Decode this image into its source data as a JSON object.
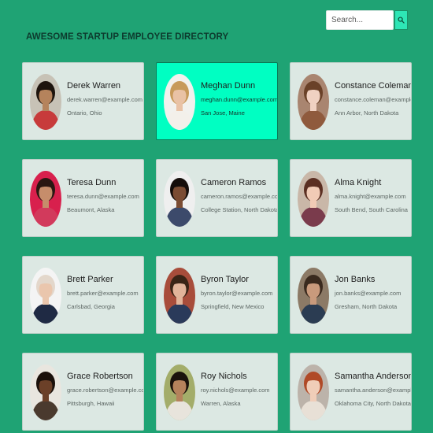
{
  "header": {
    "title": "AWESOME STARTUP EMPLOYEE DIRECTORY",
    "search": {
      "placeholder": "Search...",
      "value": "",
      "button_icon": "search-icon"
    }
  },
  "colors": {
    "background": "#1fa374",
    "card": "#dce8e3",
    "card_highlight": "#00ffc2",
    "search_button": "#2ee6b6"
  },
  "employees": [
    {
      "name": "Derek Warren",
      "email": "derek.warren@example.com",
      "location": "Ontario, Ohio",
      "highlighted": false,
      "skin": "#b5835c",
      "hair": "#1e140d",
      "shirt": "#c73b3b",
      "bg": "#c7c2b6"
    },
    {
      "name": "Meghan Dunn",
      "email": "meghan.dunn@example.com",
      "location": "San Jose, Maine",
      "highlighted": true,
      "skin": "#e9c2a5",
      "hair": "#c79a5a",
      "shirt": "#f3f0ea",
      "bg": "#f2f1ed"
    },
    {
      "name": "Constance Coleman",
      "email": "constance.coleman@example.com",
      "location": "Ann Arbor, North Dakota",
      "highlighted": false,
      "skin": "#f0d1c2",
      "hair": "#6a4128",
      "shirt": "#8f5a3d",
      "bg": "#a98570"
    },
    {
      "name": "Teresa Dunn",
      "email": "teresa.dunn@example.com",
      "location": "Beaumont, Alaska",
      "highlighted": false,
      "skin": "#c68d6b",
      "hair": "#2a1712",
      "shirt": "#d23a5c",
      "bg": "#d8204d"
    },
    {
      "name": "Cameron Ramos",
      "email": "cameron.ramos@example.com",
      "location": "College Station, North Dakota",
      "highlighted": false,
      "skin": "#7b4c33",
      "hair": "#140d0a",
      "shirt": "#3c4a6b",
      "bg": "#efefef"
    },
    {
      "name": "Alma Knight",
      "email": "alma.knight@example.com",
      "location": "South Bend, South Carolina",
      "highlighted": false,
      "skin": "#f1cbb6",
      "hair": "#5b2f22",
      "shirt": "#7a3b4c",
      "bg": "#c9b7a8"
    },
    {
      "name": "Brett Parker",
      "email": "brett.parker@example.com",
      "location": "Carlsbad, Georgia",
      "highlighted": false,
      "skin": "#eac6ad",
      "hair": "#e3d7cb",
      "shirt": "#1f2a44",
      "bg": "#f4f4f4"
    },
    {
      "name": "Byron Taylor",
      "email": "byron.taylor@example.com",
      "location": "Springfield, New Mexico",
      "highlighted": false,
      "skin": "#e2b49a",
      "hair": "#3a2416",
      "shirt": "#2a3a5a",
      "bg": "#a84d3b"
    },
    {
      "name": "Jon Banks",
      "email": "jon.banks@example.com",
      "location": "Gresham, North Dakota",
      "highlighted": false,
      "skin": "#c99a7c",
      "hair": "#3a2a1e",
      "shirt": "#2b3c52",
      "bg": "#8c7a66"
    },
    {
      "name": "Grace Robertson",
      "email": "grace.robertson@example.com",
      "location": "Pittsburgh, Hawaii",
      "highlighted": false,
      "skin": "#6b4028",
      "hair": "#1a100a",
      "shirt": "#4a3a2e",
      "bg": "#e9e6df"
    },
    {
      "name": "Roy Nichols",
      "email": "roy.nichols@example.com",
      "location": "Warren, Alaska",
      "highlighted": false,
      "skin": "#b5825c",
      "hair": "#1a120c",
      "shirt": "#e8e4dc",
      "bg": "#a3ad6a"
    },
    {
      "name": "Samantha Anderson",
      "email": "samantha.anderson@example.com",
      "location": "Oklahoma City, North Dakota",
      "highlighted": false,
      "skin": "#f0cdb8",
      "hair": "#b04a27",
      "shirt": "#e8e0d6",
      "bg": "#bcb3aa"
    }
  ]
}
